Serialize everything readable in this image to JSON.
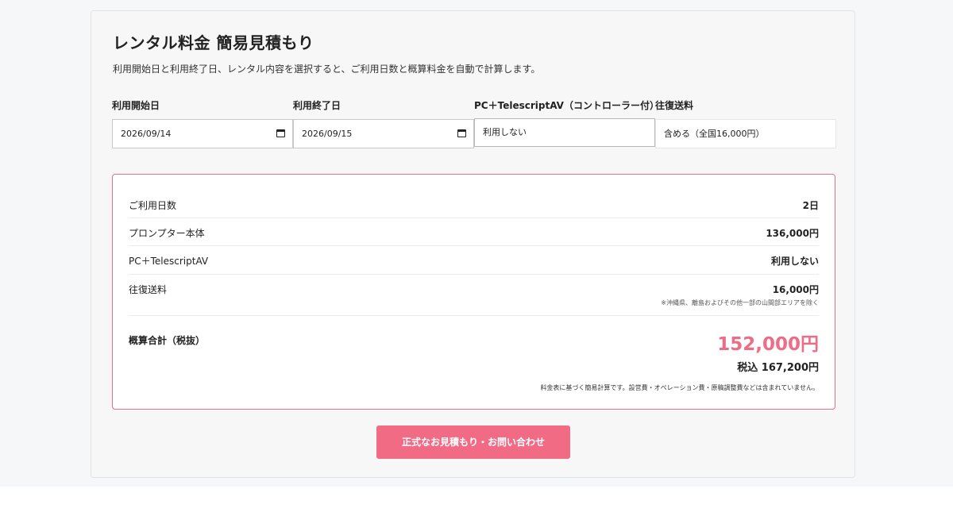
{
  "header": {
    "title": "レンタル料金 簡易見積もり",
    "description": "利用開始日と利用終了日、レンタル内容を選択すると、ご利用日数と概算料金を自動で計算します。"
  },
  "form": {
    "start_date": {
      "label": "利用開始日",
      "value": "2026/09/14"
    },
    "end_date": {
      "label": "利用終了日",
      "value": "2026/09/15"
    },
    "pc_option": {
      "label": "PC＋TelescriptAV（コントローラー付）",
      "value": "利用しない"
    },
    "shipping": {
      "label": "往復送料",
      "value": "含める（全国16,000円）"
    }
  },
  "summary": {
    "rows": [
      {
        "label": "ご利用日数",
        "value": "2日"
      },
      {
        "label": "プロンプター本体",
        "value": "136,000円"
      },
      {
        "label": "PC＋TelescriptAV",
        "value": "利用しない"
      },
      {
        "label": "往復送料",
        "value": "16,000円",
        "note": "※沖縄県、離島およびその他一部の山間部エリアを除く"
      }
    ],
    "total_label": "概算合計（税抜）",
    "total_price": "152,000円",
    "total_tax_included": "税込 167,200円",
    "total_note": "料金表に基づく簡易計算です。設営費・オペレーション費・原稿調整費などは含まれていません。"
  },
  "cta": {
    "label": "正式なお見積もり・お問い合わせ"
  },
  "colors": {
    "accent": "#f16b85",
    "price": "#ee6d86",
    "border_accent": "#e8708a"
  },
  "icons": {
    "date_picker": "calendar-icon"
  }
}
